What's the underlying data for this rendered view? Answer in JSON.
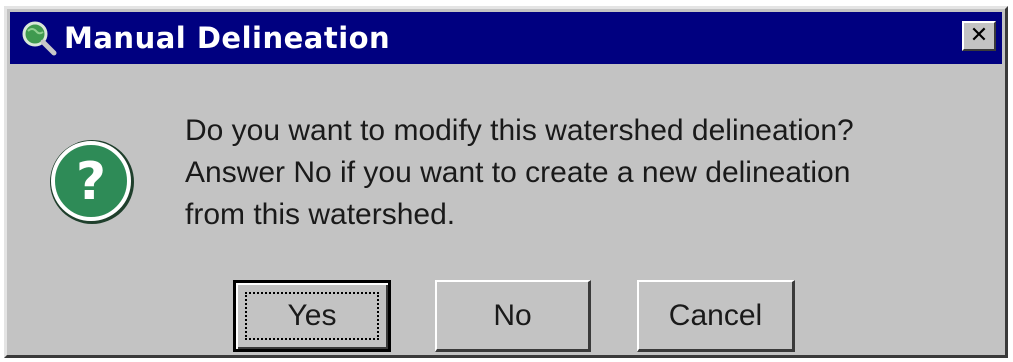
{
  "window": {
    "title": "Manual Delineation",
    "close_label": "✕",
    "app_icon": "globe-magnifier-icon"
  },
  "dialog": {
    "icon": "question-icon",
    "icon_glyph": "?",
    "message_lines": [
      "Do you want to modify this watershed delineation?",
      "Answer No if you want to create a new delineation",
      "from this watershed."
    ]
  },
  "buttons": {
    "yes": "Yes",
    "no": "No",
    "cancel": "Cancel"
  },
  "colors": {
    "titlebar": "#000080",
    "face": "#c3c3c3",
    "question_icon": "#2e8b57"
  }
}
